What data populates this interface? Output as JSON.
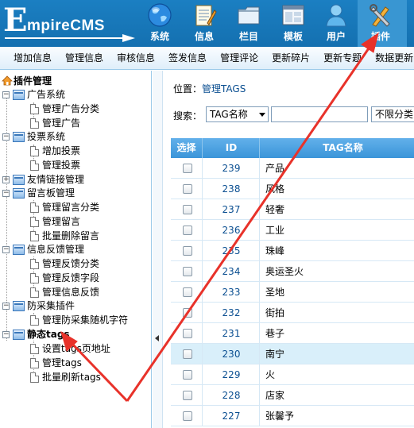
{
  "header": {
    "logo_text": "mpireCMS",
    "logo_big": "E",
    "nav": [
      {
        "label": "系统",
        "icon": "globe-icon"
      },
      {
        "label": "信息",
        "icon": "notepad-icon"
      },
      {
        "label": "栏目",
        "icon": "folder-icon"
      },
      {
        "label": "模板",
        "icon": "template-window-icon"
      },
      {
        "label": "用户",
        "icon": "user-icon"
      },
      {
        "label": "插件",
        "icon": "tools-icon",
        "active": true
      }
    ]
  },
  "subbar": [
    "增加信息",
    "管理信息",
    "审核信息",
    "签发信息",
    "管理评论",
    "更新碎片",
    "更新专题",
    "数据更新"
  ],
  "tree": {
    "root": "插件管理",
    "groups": [
      {
        "label": "广告系统",
        "items": [
          "管理广告分类",
          "管理广告"
        ]
      },
      {
        "label": "投票系统",
        "items": [
          "增加投票",
          "管理投票"
        ]
      },
      {
        "label": "友情链接管理",
        "items": [],
        "collapsed": true
      },
      {
        "label": "留言板管理",
        "items": [
          "管理留言分类",
          "管理留言",
          "批量删除留言"
        ]
      },
      {
        "label": "信息反馈管理",
        "items": [
          "管理反馈分类",
          "管理反馈字段",
          "管理信息反馈"
        ]
      },
      {
        "label": "防采集插件",
        "items": [
          "管理防采集随机字符"
        ]
      },
      {
        "label": "静态tags",
        "items": [
          "设置tags页地址",
          "管理tags",
          "批量刷新tags"
        ]
      }
    ]
  },
  "main": {
    "crumb_prefix": "位置：",
    "crumb_link": "管理TAGS",
    "search_label": "搜索：",
    "search_field": "TAG名称",
    "search_value": "",
    "search_scope": "不限分类",
    "columns": {
      "select": "选择",
      "id": "ID",
      "name": "TAG名称"
    },
    "rows": [
      {
        "id": "239",
        "name": "产品"
      },
      {
        "id": "238",
        "name": "风格"
      },
      {
        "id": "237",
        "name": "轻奢"
      },
      {
        "id": "236",
        "name": "工业"
      },
      {
        "id": "235",
        "name": "珠峰"
      },
      {
        "id": "234",
        "name": "奥运圣火"
      },
      {
        "id": "233",
        "name": "圣地"
      },
      {
        "id": "232",
        "name": "街拍"
      },
      {
        "id": "231",
        "name": "巷子"
      },
      {
        "id": "230",
        "name": "南宁",
        "highlight": true
      },
      {
        "id": "229",
        "name": "火"
      },
      {
        "id": "228",
        "name": "店家"
      },
      {
        "id": "227",
        "name": "张馨予"
      }
    ]
  },
  "colors": {
    "header_blue": "#1675b8",
    "row_highlight": "#d9effa",
    "link": "#0b4f91",
    "annotation_red": "#e8322a"
  }
}
